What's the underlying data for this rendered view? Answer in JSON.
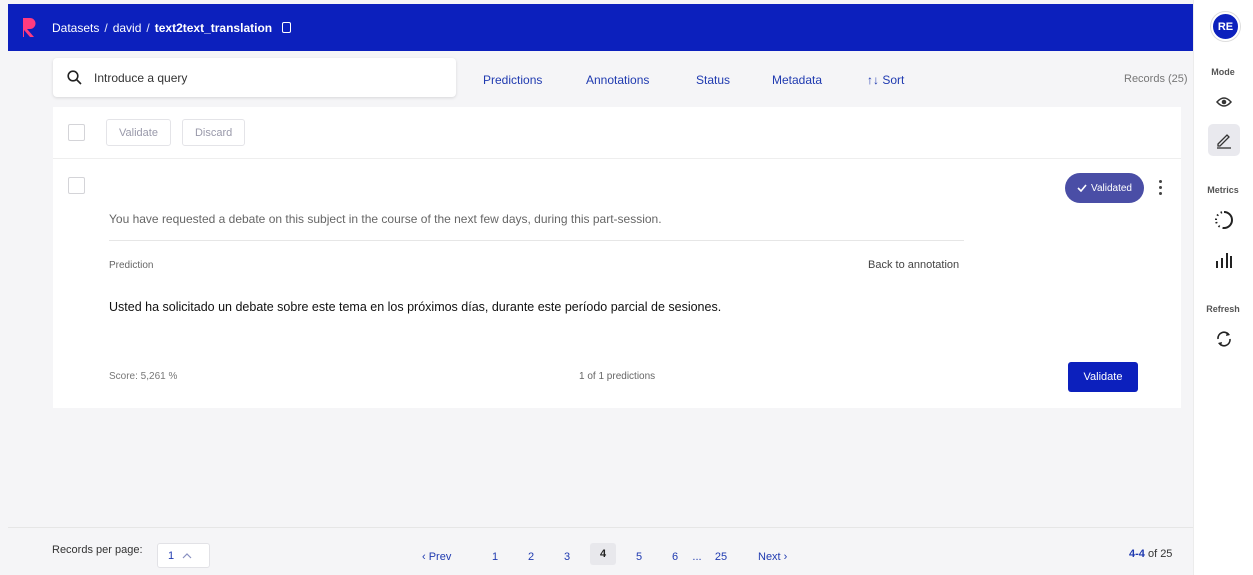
{
  "topbar": {
    "breadcrumbs": [
      "Datasets",
      "david",
      "text2text_translation"
    ],
    "separator": "/",
    "logo_letter": "R",
    "avatar": "RE"
  },
  "search": {
    "placeholder": "Introduce a query"
  },
  "filters": [
    "Predictions",
    "Annotations",
    "Status",
    "Metadata",
    "↑↓ Sort"
  ],
  "records_count": "Records (25)",
  "bulk": {
    "validate": "Validate",
    "discard": "Discard"
  },
  "record": {
    "status": "Validated",
    "source": "You have requested a debate on this subject in the course of the next few days, during this part-session.",
    "prediction_label": "Prediction",
    "back_to_annotation": "Back to annotation",
    "translation": "Usted ha solicitado un debate sobre este tema en los próximos días, durante este período parcial de sesiones.",
    "score": "Score: 5,261 %",
    "predictions_count": "1 of 1 predictions",
    "validate": "Validate"
  },
  "sidebar": {
    "mode_label": "Mode",
    "metrics_label": "Metrics",
    "refresh_label": "Refresh"
  },
  "footer": {
    "rpp_label": "Records per page:",
    "rpp_value": "1",
    "prev": "‹ Prev",
    "next": "Next ›",
    "pages": [
      "1",
      "2",
      "3",
      "4",
      "5",
      "6",
      "...",
      "25"
    ],
    "current_page": "4",
    "range_bold": "4-4",
    "range_rest": " of 25"
  },
  "colors": {
    "primary": "#0c20bd",
    "status": "#4a4ea6",
    "link": "#1f3ab0"
  }
}
